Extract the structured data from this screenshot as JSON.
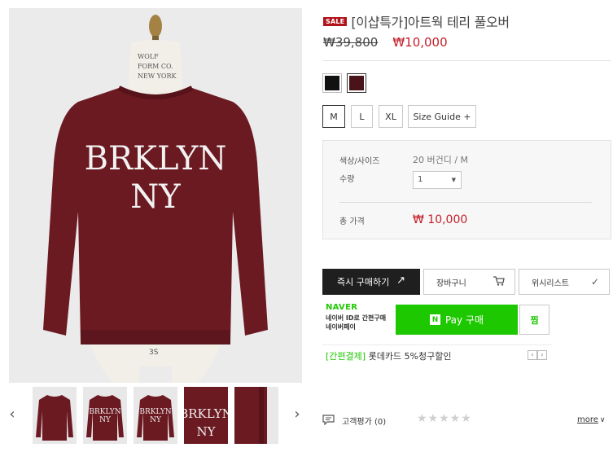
{
  "product": {
    "sale_badge": "SALE",
    "title": "[이샵특가]아트웍 테리 풀오버",
    "price_original": "₩39,800",
    "price_sale": "₩10,000",
    "print_line1": "BRKLYN",
    "print_line2": "NY",
    "mannequin_tag": "3S"
  },
  "colors": [
    {
      "name": "black",
      "hex": "#111111",
      "selected": false
    },
    {
      "name": "burgundy",
      "hex": "#4a1319",
      "selected": true
    }
  ],
  "sizes": [
    {
      "label": "M",
      "selected": true
    },
    {
      "label": "L",
      "selected": false
    },
    {
      "label": "XL",
      "selected": false
    }
  ],
  "size_guide_label": "Size Guide +",
  "options": {
    "color_size_label": "색상/사이즈",
    "color_size_value": "20 버건디 / M",
    "qty_label": "수량",
    "qty_value": "1",
    "total_label": "총 가격",
    "total_value": "₩ 10,000"
  },
  "buttons": {
    "buy_now": "즉시 구매하기",
    "cart": "장바구니",
    "wishlist": "위시리스트"
  },
  "naver": {
    "logo": "NAVER",
    "desc_line1": "네이버 ID로 간편구매",
    "desc_line2": "네이버페이",
    "pay_n": "N",
    "pay_label": "Pay 구매",
    "zzim": "찜"
  },
  "promo": {
    "tag": "[간편결제]",
    "text": " 롯데카드 5%청구할인"
  },
  "review": {
    "label": "고객평가",
    "count": "(0)",
    "stars": "★★★★★",
    "more": "more"
  },
  "colors_theme": {
    "accent_red": "#c4202b",
    "naver_green": "#1ec800",
    "sweater": "#6b1a22"
  }
}
